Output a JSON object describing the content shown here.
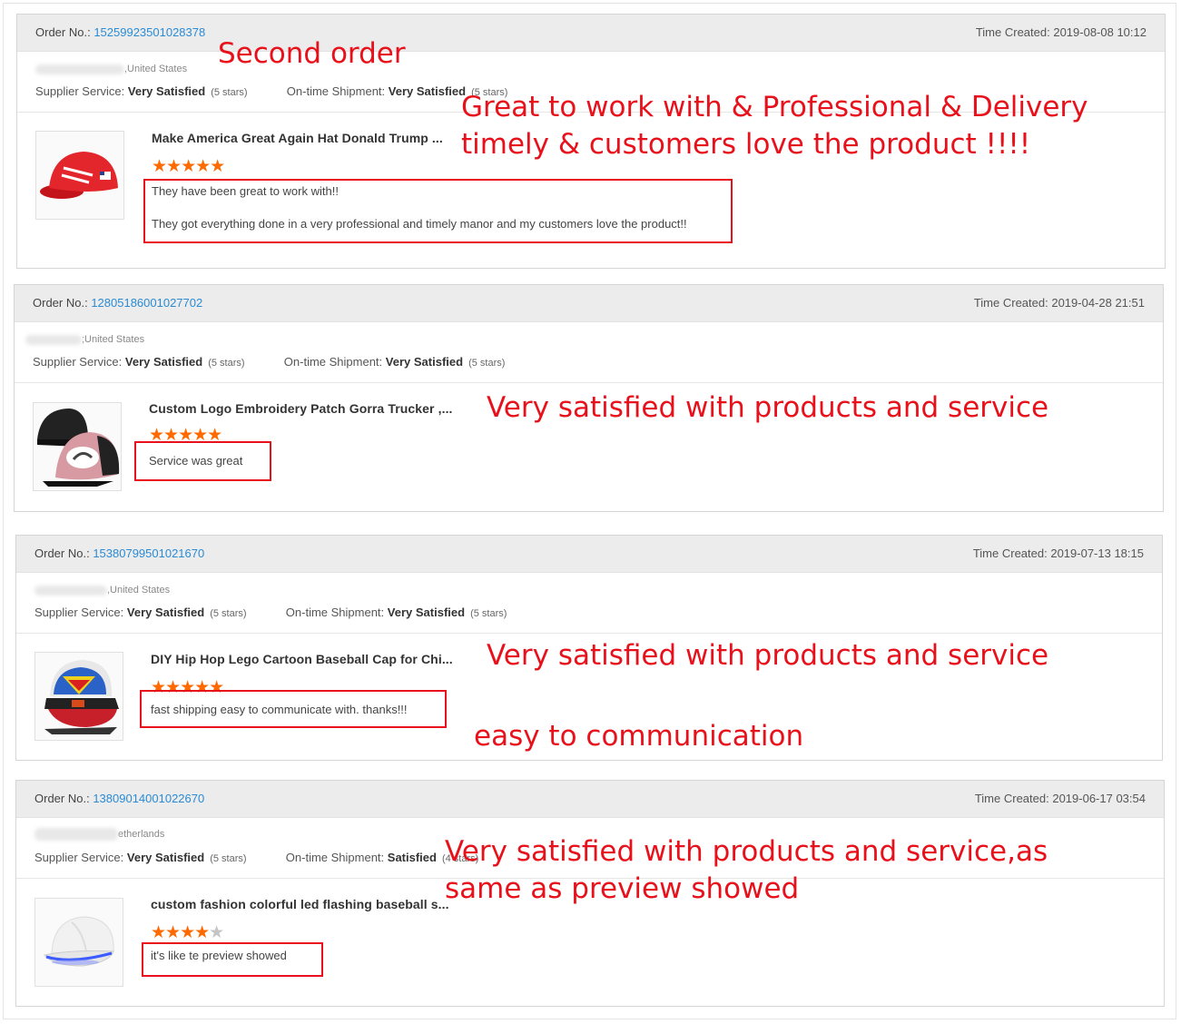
{
  "labels": {
    "order_no": "Order No.:",
    "time_created": "Time Created:",
    "supplier_service": "Supplier Service:",
    "ontime_shipment": "On-time Shipment:"
  },
  "orders": [
    {
      "order_no": "15259923501028378",
      "time_created": "2019-08-08 10:12",
      "location": ",United States",
      "supplier_rating": "Very Satisfied",
      "supplier_stars": "(5 stars)",
      "shipment_rating": "Very Satisfied",
      "shipment_stars": "(5 stars)",
      "product_name": "Make America Great Again Hat Donald Trump ...",
      "product_image": "red-cap",
      "stars": 5,
      "review_line1": "They have been great to work with!!",
      "review_line2": "They got everything done in a very professional and timely manor and my customers love the product!!"
    },
    {
      "order_no": "12805186001027702",
      "time_created": "2019-04-28 21:51",
      "location": ";United States",
      "supplier_rating": "Very Satisfied",
      "supplier_stars": "(5 stars)",
      "shipment_rating": "Very Satisfied",
      "shipment_stars": "(5 stars)",
      "product_name": "Custom Logo Embroidery Patch Gorra Trucker ,...",
      "product_image": "trucker-cap",
      "stars": 5,
      "review_line1": "Service was great"
    },
    {
      "order_no": "15380799501021670",
      "time_created": "2019-07-13 18:15",
      "location": ",United States",
      "supplier_rating": "Very Satisfied",
      "supplier_stars": "(5 stars)",
      "shipment_rating": "Very Satisfied",
      "shipment_stars": "(5 stars)",
      "product_name": "DIY Hip Hop Lego Cartoon Baseball Cap for Chi...",
      "product_image": "superman-cap",
      "stars": 5,
      "review_line1": "fast shipping easy to communicate with. thanks!!!"
    },
    {
      "order_no": "13809014001022670",
      "time_created": "2019-06-17 03:54",
      "location": "etherlands",
      "supplier_rating": "Very Satisfied",
      "supplier_stars": "(5 stars)",
      "shipment_rating": "Satisfied",
      "shipment_stars": "(4 stars)",
      "product_name": "custom fashion colorful led flashing baseball s...",
      "product_image": "led-cap",
      "stars": 4,
      "review_line1": "it's like te preview showed"
    }
  ],
  "annotations": {
    "second_order": "Second order",
    "order1_line1": "Great to work with & Professional & Delivery",
    "order1_line2": "timely & customers love the product !!!!",
    "order2": "Very satisfied with products and service",
    "order3_line1": "Very satisfied with products and service",
    "order3_line2": "easy to communication",
    "order4_line1": "Very satisfied with products and service,as",
    "order4_line2": "same as preview showed"
  },
  "colors": {
    "annotation_red": "#e8111b",
    "order_link_blue": "#2a8bd5",
    "star_orange": "#ff6a00",
    "header_gray": "#ececec"
  }
}
